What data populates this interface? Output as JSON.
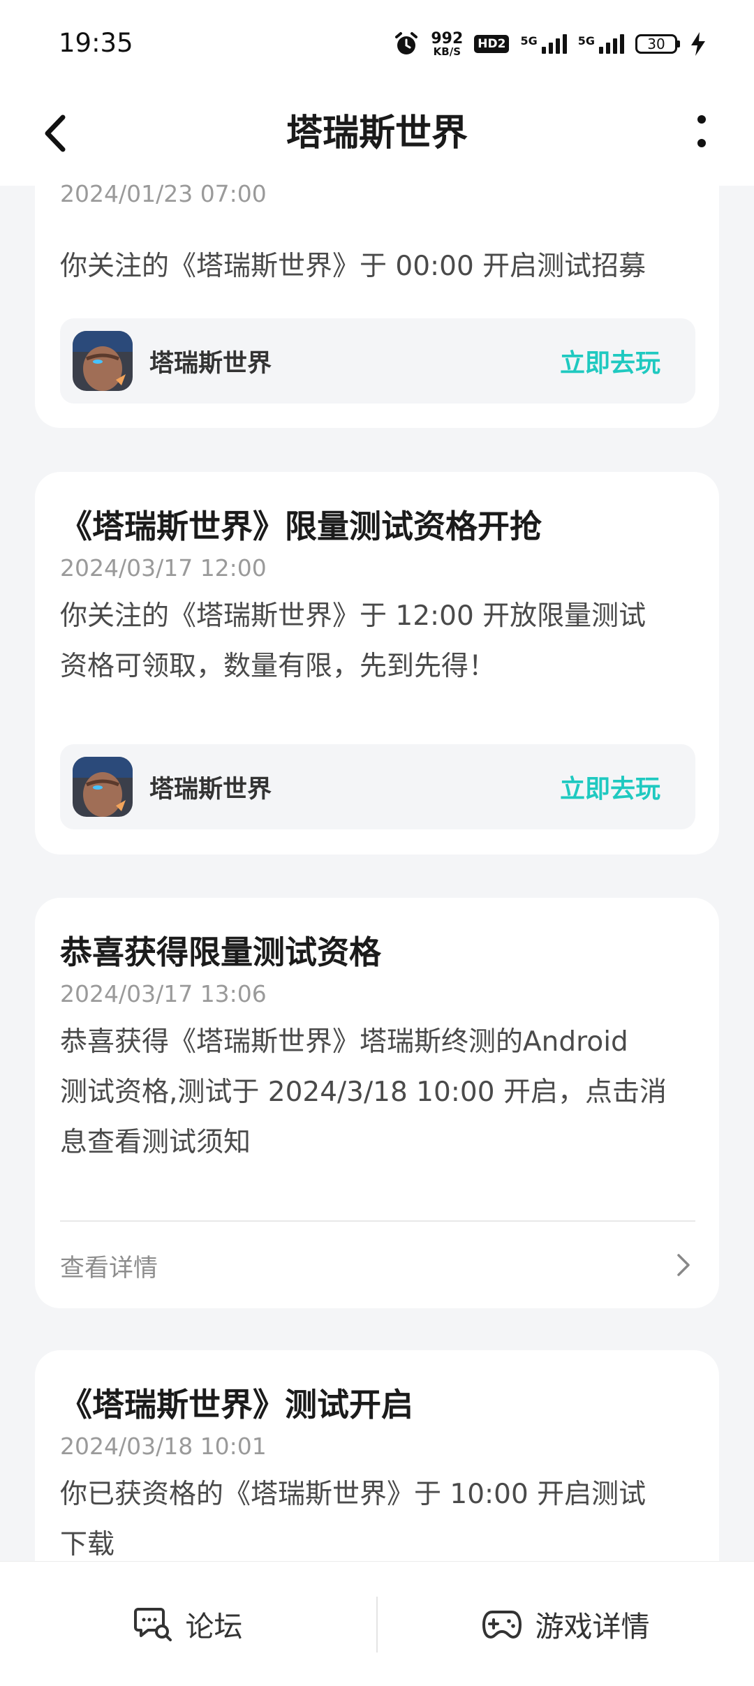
{
  "status": {
    "time": "19:35",
    "net_speed": "992",
    "net_unit": "KB/S",
    "hd": "HD2",
    "sig1": "5G",
    "sig2": "5G",
    "battery": "30"
  },
  "header": {
    "title": "塔瑞斯世界"
  },
  "cards": [
    {
      "date": "2024/01/23 07:00",
      "body": "你关注的《塔瑞斯世界》于 00:00 开启测试招募",
      "game": {
        "name": "塔瑞斯世界",
        "action": "立即去玩"
      }
    },
    {
      "title": "《塔瑞斯世界》限量测试资格开抢",
      "date": "2024/03/17 12:00",
      "body_line1": "你关注的《塔瑞斯世界》于 12:00 开放限量测试",
      "body_line2": "资格可领取，数量有限，先到先得！",
      "game": {
        "name": "塔瑞斯世界",
        "action": "立即去玩"
      }
    },
    {
      "title": "恭喜获得限量测试资格",
      "date": "2024/03/17 13:06",
      "body_line1": "恭喜获得《塔瑞斯世界》塔瑞斯终测的Android",
      "body_line2": "测试资格,测试于 2024/3/18 10:00 开启，点击消",
      "body_line3": "息查看测试须知",
      "link": "查看详情"
    },
    {
      "title": "《塔瑞斯世界》测试开启",
      "date": "2024/03/18 10:01",
      "body_line1": "你已获资格的《塔瑞斯世界》于 10:00 开启测试",
      "body_line2": "下载"
    }
  ],
  "bottom": {
    "forum": "论坛",
    "game_detail": "游戏详情"
  },
  "colors": {
    "accent": "#1fc9c0",
    "background": "#f4f5f7"
  }
}
